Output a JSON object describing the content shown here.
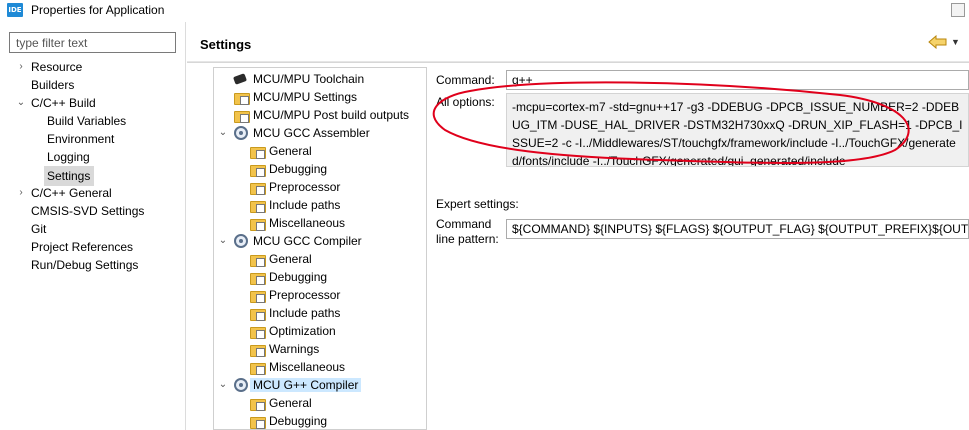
{
  "window": {
    "icon_text": "IDE",
    "title": "Properties for Application"
  },
  "filter": {
    "placeholder": "type filter text"
  },
  "nav": {
    "items": [
      {
        "label": "Resource",
        "expander": "›"
      },
      {
        "label": "Builders"
      },
      {
        "label": "C/C++ Build",
        "expander": "⌄"
      },
      {
        "label": "Build Variables"
      },
      {
        "label": "Environment"
      },
      {
        "label": "Logging"
      },
      {
        "label": "Settings"
      },
      {
        "label": "C/C++ General",
        "expander": "›"
      },
      {
        "label": "CMSIS-SVD Settings"
      },
      {
        "label": "Git"
      },
      {
        "label": "Project References"
      },
      {
        "label": "Run/Debug Settings"
      }
    ]
  },
  "settings": {
    "title": "Settings",
    "back_icon": "back-arrow-icon",
    "menu_icon": "chevron-down-icon",
    "menu_glyph": "▼"
  },
  "tools": {
    "items": [
      {
        "label": "MCU/MPU Toolchain",
        "icon": "chip-icon"
      },
      {
        "label": "MCU/MPU Settings",
        "icon": "folder-settings-icon"
      },
      {
        "label": "MCU/MPU Post build outputs",
        "icon": "folder-settings-icon"
      },
      {
        "label": "MCU GCC Assembler",
        "icon": "gear-icon",
        "expander": "⌄"
      },
      {
        "label": "General",
        "icon": "folder-settings-icon"
      },
      {
        "label": "Debugging",
        "icon": "folder-settings-icon"
      },
      {
        "label": "Preprocessor",
        "icon": "folder-settings-icon"
      },
      {
        "label": "Include paths",
        "icon": "folder-settings-icon"
      },
      {
        "label": "Miscellaneous",
        "icon": "folder-settings-icon"
      },
      {
        "label": "MCU GCC Compiler",
        "icon": "gear-icon",
        "expander": "⌄"
      },
      {
        "label": "General",
        "icon": "folder-settings-icon"
      },
      {
        "label": "Debugging",
        "icon": "folder-settings-icon"
      },
      {
        "label": "Preprocessor",
        "icon": "folder-settings-icon"
      },
      {
        "label": "Include paths",
        "icon": "folder-settings-icon"
      },
      {
        "label": "Optimization",
        "icon": "folder-settings-icon"
      },
      {
        "label": "Warnings",
        "icon": "folder-settings-icon"
      },
      {
        "label": "Miscellaneous",
        "icon": "folder-settings-icon"
      },
      {
        "label": "MCU G++ Compiler",
        "icon": "gear-icon",
        "expander": "⌄"
      },
      {
        "label": "General",
        "icon": "folder-settings-icon"
      },
      {
        "label": "Debugging",
        "icon": "folder-settings-icon"
      }
    ]
  },
  "form": {
    "command_label": "Command:",
    "command_value": "g++",
    "all_options_label": "All options:",
    "all_options_value": "-mcpu=cortex-m7 -std=gnu++17 -g3 -DDEBUG -DPCB_ISSUE_NUMBER=2 -DDEBUG_ITM -DUSE_HAL_DRIVER -DSTM32H730xxQ -DRUN_XIP_FLASH=1 -DPCB_ISSUE=2 -c -I../Middlewares/ST/touchgfx/framework/include -I../TouchGFX/generated/fonts/include -I../TouchGFX/generated/gui_generated/include",
    "expert_label": "Expert settings:",
    "pattern_label_line1": "Command",
    "pattern_label_line2": "line pattern:",
    "pattern_value": "${COMMAND} ${INPUTS} ${FLAGS} ${OUTPUT_FLAG} ${OUTPUT_PREFIX}${OUTPUT}"
  },
  "colors": {
    "annotation": "#e0001b",
    "selection": "#cce8ff",
    "nav_selection": "#d9d9d9"
  }
}
